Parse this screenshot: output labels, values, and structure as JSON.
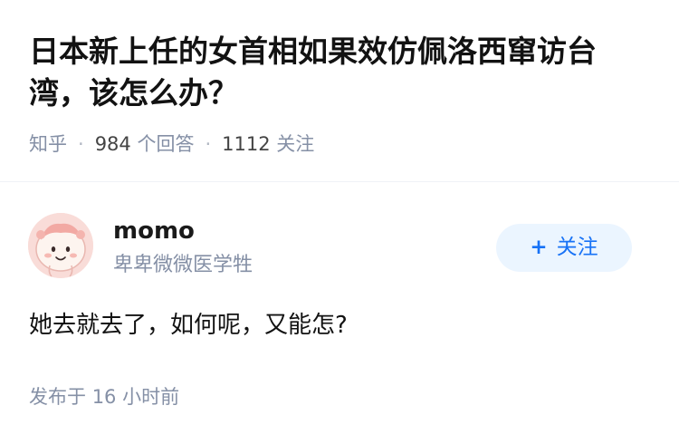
{
  "question": {
    "title": "日本新上任的女首相如果效仿佩洛西窜访台湾，该怎么办？",
    "source": "知乎",
    "answer_count": "984",
    "answer_label": "个回答",
    "follower_count": "1112",
    "follower_label": "关注"
  },
  "answer": {
    "author": {
      "name": "momo",
      "bio": "卑卑微微医学牲",
      "avatar_icon": "cartoon-avatar-icon"
    },
    "follow_button": {
      "label": "关注",
      "icon": "plus-icon"
    },
    "content": "她去就去了，如何呢，又能怎?",
    "published_label": "发布于",
    "published_time": "16 小时前"
  },
  "colors": {
    "accent": "#1772f6",
    "button_bg": "#ebf5ff",
    "meta_gray": "#8590a6",
    "text": "#121212"
  }
}
